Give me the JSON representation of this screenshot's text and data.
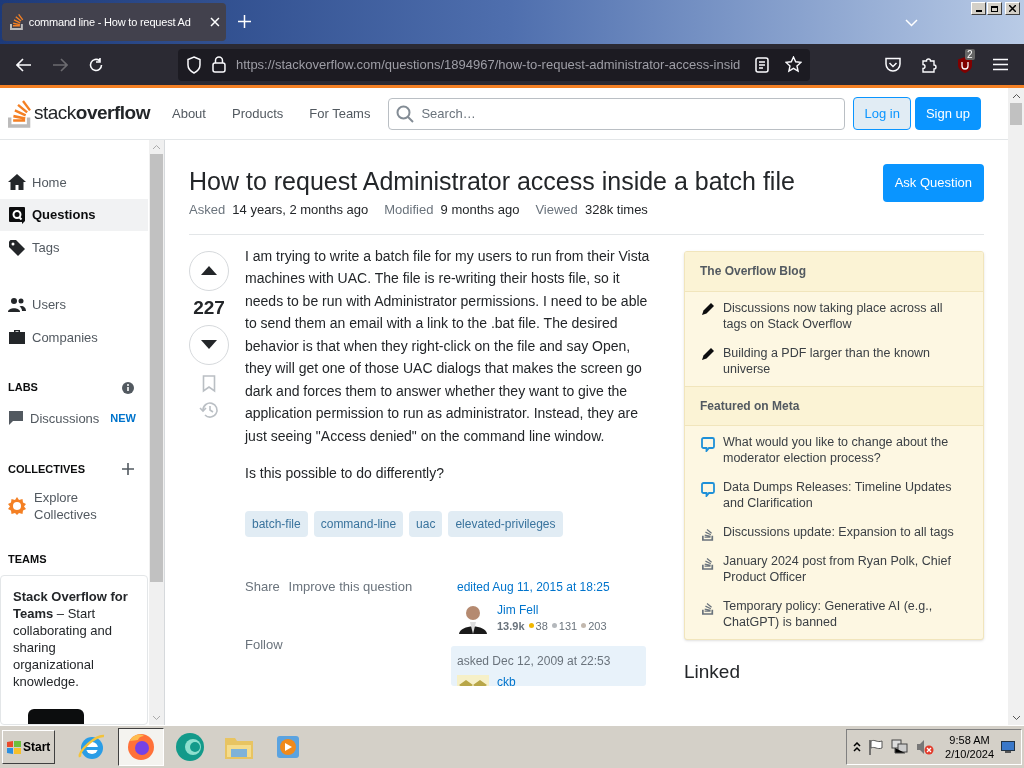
{
  "browser": {
    "tab": {
      "title": "command line - How to request Ad",
      "selected": true
    },
    "url": "https://stackoverflow.com/questions/1894967/how-to-request-administrator-access-insid",
    "extension_badge": "2"
  },
  "header": {
    "logo": "stack**overflow**",
    "nav": [
      "About",
      "Products",
      "For Teams"
    ],
    "search": {
      "placeholder": "Search…"
    },
    "buttons": [
      {
        "label": "Log in",
        "kind": "outline"
      },
      {
        "label": "Sign up",
        "kind": "primary"
      }
    ]
  },
  "sidebar": {
    "items": [
      {
        "label": "Home",
        "selected": false
      },
      {
        "label": "Questions",
        "selected": true
      },
      {
        "label": "Tags",
        "selected": false
      },
      {
        "label": "Users",
        "selected": false
      },
      {
        "label": "Companies",
        "selected": false
      }
    ],
    "sections": [
      {
        "title": "LABS",
        "items": [
          {
            "label": "Discussions",
            "badge": "NEW"
          }
        ]
      },
      {
        "title": "COLLECTIVES",
        "items": [
          {
            "label": "Explore Collectives"
          }
        ]
      },
      {
        "title": "TEAMS"
      }
    ],
    "teams_promo": "**Stack Overflow for Teams** – Start collaborating and sharing organizational knowledge."
  },
  "question": {
    "title": "How to request Administrator access inside a batch file",
    "stats": [
      {
        "label": "Asked",
        "value": "14 years, 2 months ago"
      },
      {
        "label": "Modified",
        "value": "9 months ago"
      },
      {
        "label": "Viewed",
        "value": "328k times"
      }
    ],
    "ask_button": "Ask Question",
    "score": "227",
    "body": [
      "I am trying to write a batch file for my users to run from their Vista machines with UAC. The file is re-writing their hosts file, so it needs to be run with Administrator permissions. I need to be able to send them an email with a link to the .bat file. The desired behavior is that when they right-click on the file and say Open, they will get one of those UAC dialogs that makes the screen go dark and forces them to answer whether they want to give the application permission to run as administrator. Instead, they are just seeing \"Access denied\" on the command line window.",
      "Is this possible to do differently?"
    ],
    "tags": [
      "batch-file",
      "command-line",
      "uac",
      "elevated-privileges"
    ],
    "actions": [
      "Share",
      "Improve this question",
      "Follow"
    ],
    "edited": {
      "label": "edited Aug 11, 2015 at 18:25",
      "user": "Jim Fell",
      "reputation": "13.9k",
      "badges": [
        {
          "count": "38",
          "color": "#f1b600"
        },
        {
          "count": "131",
          "color": "#b4b8bc"
        },
        {
          "count": "203",
          "color": "#c2b8ae"
        }
      ]
    },
    "asked": {
      "label": "asked Dec 12, 2009 at 22:53",
      "user": "ckb"
    }
  },
  "aside": {
    "widgets": [
      {
        "title": "The Overflow Blog",
        "items": [
          {
            "kind": "pencil",
            "text": "Discussions now taking place across all tags on Stack Overflow"
          },
          {
            "kind": "pencil",
            "text": "Building a PDF larger than the known universe"
          }
        ]
      },
      {
        "title": "Featured on Meta",
        "items": [
          {
            "kind": "chat",
            "text": "What would you like to change about the moderator election process?"
          },
          {
            "kind": "chat",
            "text": "Data Dumps Releases: Timeline Updates and Clarification"
          },
          {
            "kind": "stack",
            "text": "Discussions update: Expansion to all tags"
          },
          {
            "kind": "stack",
            "text": "January 2024 post from Ryan Polk, Chief Product Officer"
          },
          {
            "kind": "stack",
            "text": "Temporary policy: Generative AI (e.g., ChatGPT) is banned"
          }
        ]
      }
    ],
    "linked_heading": "Linked"
  },
  "taskbar": {
    "start": "Start",
    "apps": [
      {
        "selected": false
      },
      {
        "selected": true
      },
      {
        "selected": false
      },
      {
        "selected": false
      },
      {
        "selected": false
      }
    ],
    "time": "9:58 AM",
    "date": "2/10/2024"
  }
}
